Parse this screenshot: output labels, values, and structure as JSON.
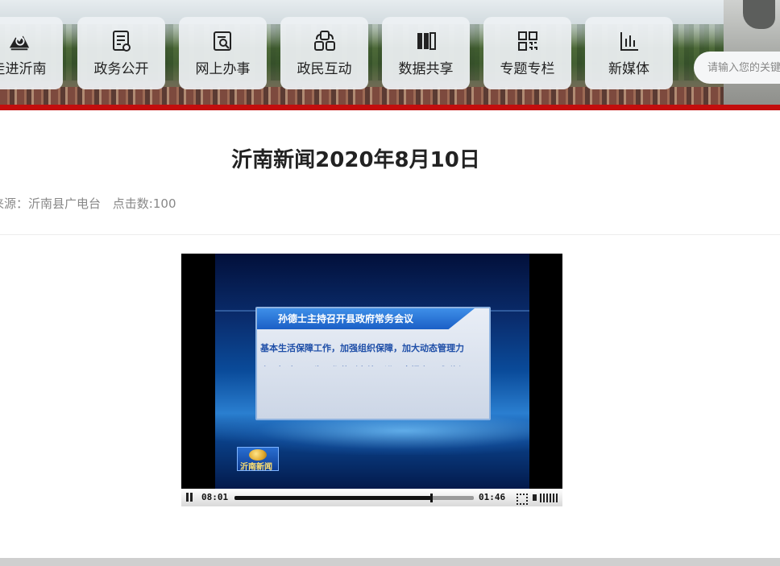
{
  "nav": {
    "items": [
      {
        "label": "走进沂南",
        "icon": "mountain-icon"
      },
      {
        "label": "政务公开",
        "icon": "document-icon"
      },
      {
        "label": "网上办事",
        "icon": "search-document-icon"
      },
      {
        "label": "政民互动",
        "icon": "interaction-icon"
      },
      {
        "label": "数据共享",
        "icon": "books-icon"
      },
      {
        "label": "专题专栏",
        "icon": "grid-icon"
      },
      {
        "label": "新媒体",
        "icon": "bar-chart-icon"
      }
    ],
    "search_placeholder": "请输入您的关键字"
  },
  "colors": {
    "accent_red": "#c30d0d",
    "nav_button_bg": "#eef1f4"
  },
  "article": {
    "title": "沂南新闻2020年8月10日",
    "source": "来源：沂南县广电台",
    "clicks": "点击数:100"
  },
  "video": {
    "headline": "孙德士主持召开县政府常务会议",
    "body_line1": "基本生活保障工作，加强组织保障，加大动态管理力",
    "body_line2": "度，把这项民生工作落到实处，进一步提高困难群众",
    "logo_text": "沂南新闻",
    "current_time": "08:01",
    "duration": "01:46",
    "progress": 0.82
  }
}
